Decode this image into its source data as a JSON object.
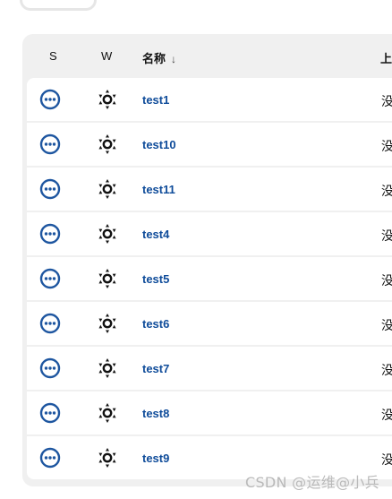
{
  "table": {
    "headers": {
      "s": "S",
      "w": "W",
      "name": "名称",
      "sort_arrow": "↓",
      "last": "上"
    },
    "rows": [
      {
        "name": "test1",
        "last": "没"
      },
      {
        "name": "test10",
        "last": "没"
      },
      {
        "name": "test11",
        "last": "没"
      },
      {
        "name": "test4",
        "last": "没"
      },
      {
        "name": "test5",
        "last": "没"
      },
      {
        "name": "test6",
        "last": "没"
      },
      {
        "name": "test7",
        "last": "没"
      },
      {
        "name": "test8",
        "last": "没"
      },
      {
        "name": "test9",
        "last": "没"
      }
    ]
  },
  "icons": {
    "status": "not-built-status-icon",
    "weather": "weather-sun-icon"
  },
  "colors": {
    "status_blue": "#1e56a0",
    "link_blue": "#0f4c9a",
    "table_bg": "#f0f0f0"
  },
  "watermark": "CSDN @运维@小兵"
}
